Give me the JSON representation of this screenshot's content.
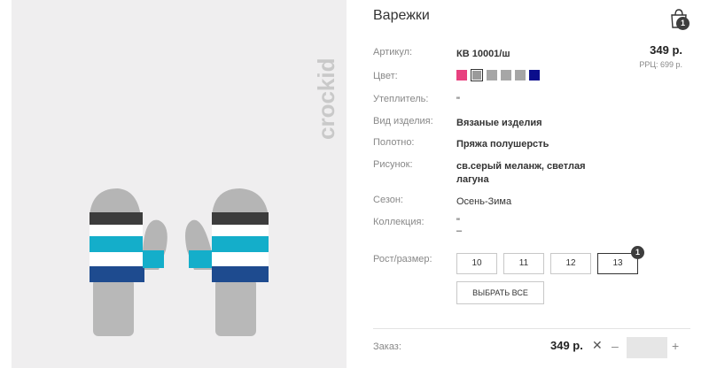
{
  "colors": {
    "accent_dark": "#3d3d3d",
    "swatches": [
      "#e8417f",
      "#9a9a9a",
      "#a6a6a6",
      "#a6a6a6",
      "#a6a6a6",
      "#0a0d8c"
    ]
  },
  "brand": {
    "logo_text": "crockid"
  },
  "product": {
    "title": "Варежки",
    "price": "349 р.",
    "rrp": "РРЦ: 699 р."
  },
  "cart": {
    "icon": "shopping-bag-icon",
    "badge": "1"
  },
  "attributes": {
    "article": {
      "label": "Артикул:",
      "value": "КВ 10001/ш"
    },
    "color": {
      "label": "Цвет:",
      "selected_index": 1
    },
    "insulation": {
      "label": "Утеплитель:",
      "value": "\""
    },
    "item_type": {
      "label": "Вид изделия:",
      "value": "Вязаные изделия"
    },
    "fabric": {
      "label": "Полотно:",
      "value": "Пряжа полушерсть"
    },
    "pattern": {
      "label": "Рисунок:",
      "value_line1": "св.серый меланж, светлая",
      "value_line2": "лагуна"
    },
    "season": {
      "label": "Сезон:",
      "value": "Осень-Зима"
    },
    "collection": {
      "label": "Коллекция:",
      "value_line1": "\"",
      "value_line2": "–"
    }
  },
  "sizes": {
    "label": "Рост/размер:",
    "options": [
      "10",
      "11",
      "12",
      "13"
    ],
    "active_index": 3,
    "active_badge": "1",
    "select_all": "ВЫБРАТЬ ВСЕ"
  },
  "order": {
    "label": "Заказ:",
    "price": "349 р.",
    "remove": "✕",
    "minus": "–",
    "plus": "+",
    "quantity": ""
  }
}
